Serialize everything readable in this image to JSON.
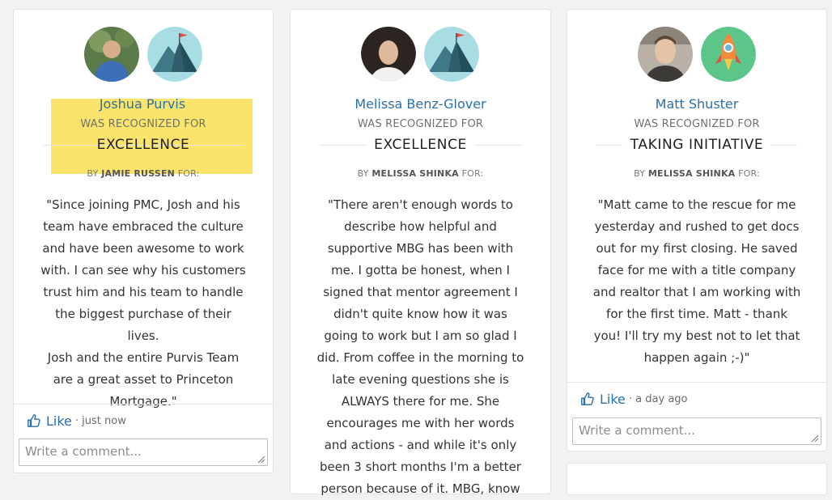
{
  "cards": [
    {
      "name": "Joshua Purvis",
      "recognized_for": "WAS RECOGNIZED FOR",
      "award": "EXCELLENCE",
      "by_prefix": "BY",
      "by_name": "JAMIE RUSSEN",
      "by_suffix": "FOR:",
      "quote_lines": [
        "\"Since joining PMC, Josh and his",
        "team have embraced the culture",
        "and have been awesome to work",
        "with. I can see why his customers",
        "trust him and his team to handle",
        "the biggest purchase of their lives.",
        "Josh and the entire Purvis Team",
        "are a great asset to Princeton",
        "Mortgage.\""
      ],
      "like_label": "Like",
      "like_time": "· just now",
      "comment_placeholder": "Write a comment...",
      "badge_icon": "mountain-flag-icon",
      "avatar_icon": "person-avatar-icon"
    },
    {
      "name": "Melissa Benz-Glover",
      "recognized_for": "WAS RECOGNIZED FOR",
      "award": "EXCELLENCE",
      "by_prefix": "BY",
      "by_name": "MELISSA SHINKA",
      "by_suffix": "FOR:",
      "quote_lines": [
        "\"There aren't enough words to",
        "describe how helpful and",
        "supportive MBG has been with",
        "me. I gotta be honest, when I",
        "signed that mentor agreement I",
        "didn't quite know how it was",
        "going to work but I am so glad I",
        "did. From coffee in the morning to",
        "late evening questions she is",
        "ALWAYS there for me. She",
        "encourages me with her words",
        "and actions - and while it's only",
        "been 3 short months I'm a better",
        "person because of it. MBG, know"
      ],
      "badge_icon": "mountain-flag-icon",
      "avatar_icon": "person-avatar-icon"
    },
    {
      "name": "Matt Shuster",
      "recognized_for": "WAS RECOGNIZED FOR",
      "award": "TAKING INITIATIVE",
      "by_prefix": "BY",
      "by_name": "MELISSA SHINKA",
      "by_suffix": "FOR:",
      "quote_lines": [
        "\"Matt came to the rescue for me",
        "yesterday and rushed to get docs",
        "out for my first closing. He saved",
        "face for me with a title company",
        "and realtor that I am working with",
        "for the first time. Matt - thank",
        "you! I'll try my best not to let that",
        "happen again ;-)\""
      ],
      "like_label": "Like",
      "like_time": "· a day ago",
      "comment_placeholder": "Write a comment...",
      "badge_icon": "rocket-icon",
      "avatar_icon": "person-avatar-icon"
    }
  ],
  "colors": {
    "name_link": "#2b6fa8",
    "highlight": "#fbe46b",
    "badge_teal": "#8fd6dc",
    "badge_green": "#5cc58a"
  }
}
